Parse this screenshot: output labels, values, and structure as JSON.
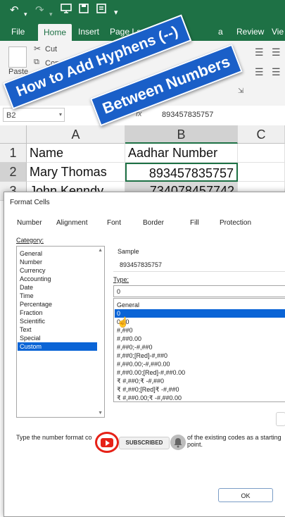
{
  "ribbon_tabs": [
    "File",
    "Home",
    "Insert",
    "Page Layo",
    "a",
    "Review",
    "Vie"
  ],
  "ribbon": {
    "cut": "Cut",
    "copy": "Copy",
    "paste": "Paste"
  },
  "formula_bar": {
    "name_box": "B2",
    "fx": "fx",
    "value": "893457835757"
  },
  "columns": [
    "A",
    "B",
    "C"
  ],
  "rows": [
    "1",
    "2",
    "3"
  ],
  "cells": {
    "a1": "Name",
    "b1": "Aadhar Number",
    "a2": "Mary Thomas",
    "b2": "893457835757",
    "a3": "John Kenndy",
    "b3": "734078457742"
  },
  "banner": {
    "line1": "How to Add Hyphens (--)",
    "line2": "Between Numbers"
  },
  "dialog": {
    "title": "Format Cells",
    "tabs": [
      "Number",
      "Alignment",
      "Font",
      "Border",
      "Fill",
      "Protection"
    ],
    "category_label": "Category:",
    "categories": [
      "General",
      "Number",
      "Currency",
      "Accounting",
      "Date",
      "Time",
      "Percentage",
      "Fraction",
      "Scientific",
      "Text",
      "Special",
      "Custom"
    ],
    "selected_category": "Custom",
    "sample_label": "Sample",
    "sample_value": "893457835757",
    "type_label": "Type:",
    "type_value": "0",
    "types": [
      "General",
      "0",
      "0.00",
      "#,##0",
      "#,##0.00",
      "#,##0;-#,##0",
      "#,##0;[Red]-#,##0",
      "#,##0.00;-#,##0.00",
      "#,##0.00;[Red]-#,##0.00",
      "₹ #,##0;₹ -#,##0",
      "₹ #,##0;[Red]₹ -#,##0",
      "₹ #,##0.00;₹ -#,##0.00"
    ],
    "selected_type": "0",
    "description": "Type the number format co",
    "description_end": "of the existing codes as a starting point.",
    "ok_label": "OK"
  },
  "subscribe": {
    "label": "SUBSCRIBED"
  },
  "colors": {
    "excel_green": "#1e7145",
    "banner_blue": "#1a5fc8",
    "selection_blue": "#0a64d6",
    "youtube_red": "#e62117"
  }
}
